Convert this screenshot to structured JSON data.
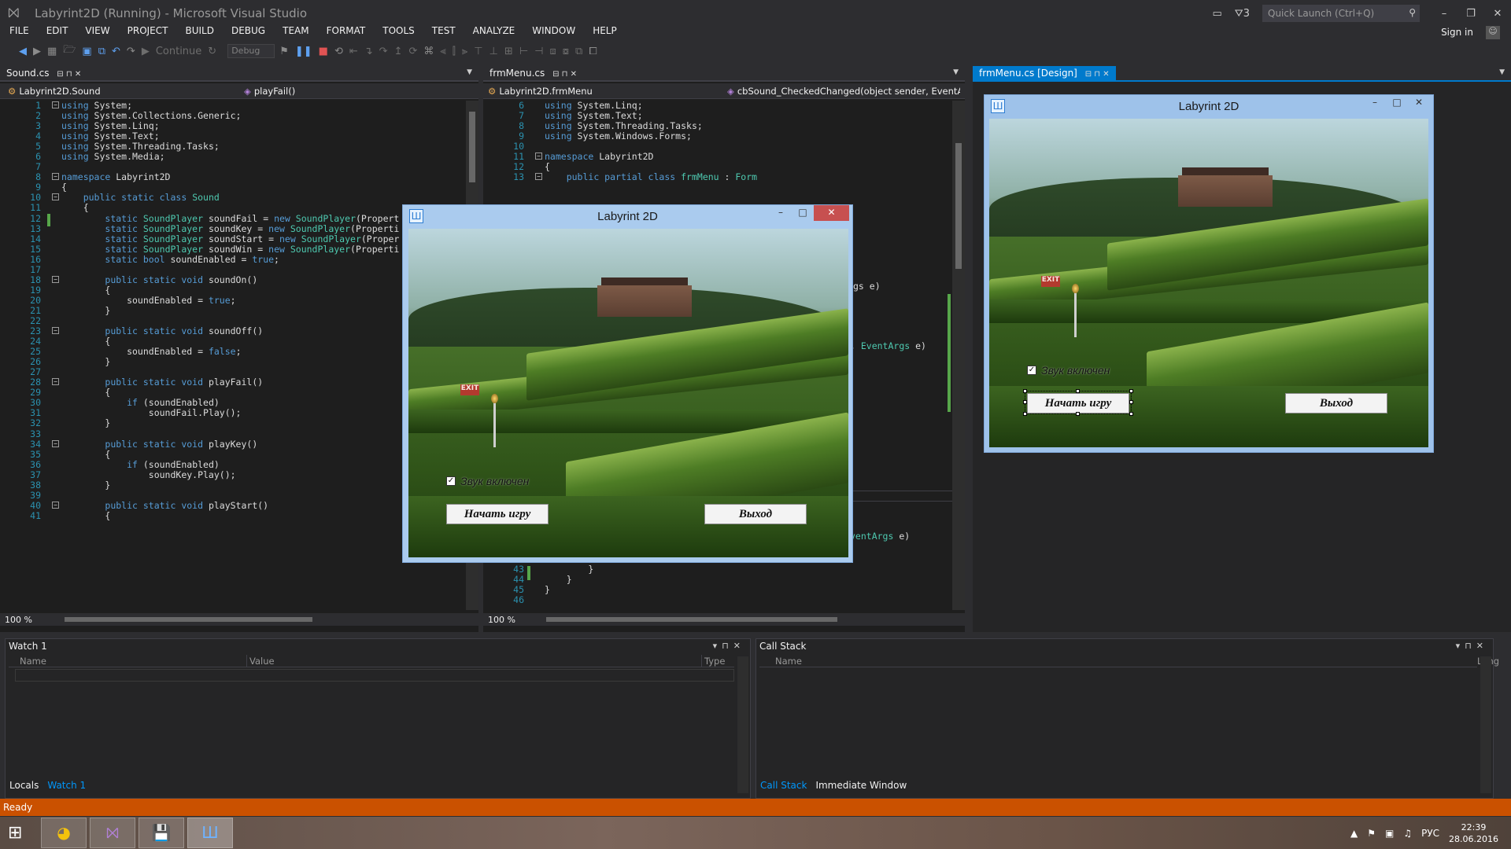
{
  "window": {
    "title": "Labyrint2D (Running) - Microsoft Visual Studio",
    "notifications_count": "3",
    "quick_launch_placeholder": "Quick Launch (Ctrl+Q)",
    "signin": "Sign in"
  },
  "menu": [
    "FILE",
    "EDIT",
    "VIEW",
    "PROJECT",
    "BUILD",
    "DEBUG",
    "TEAM",
    "FORMAT",
    "TOOLS",
    "TEST",
    "ANALYZE",
    "WINDOW",
    "HELP"
  ],
  "toolbar": {
    "continue_label": "Continue",
    "config": "Debug"
  },
  "sound_pane": {
    "tab": "Sound.cs",
    "nav_class": "Labyrint2D.Sound",
    "nav_member": "playFail()",
    "zoom": "100 %",
    "lines": [
      {
        "n": "1",
        "html": "<span class='k'>using</span> System;"
      },
      {
        "n": "2",
        "html": "<span class='k'>using</span> System.Collections.Generic;"
      },
      {
        "n": "3",
        "html": "<span class='k'>using</span> System.Linq;"
      },
      {
        "n": "4",
        "html": "<span class='k'>using</span> System.Text;"
      },
      {
        "n": "5",
        "html": "<span class='k'>using</span> System.Threading.Tasks;"
      },
      {
        "n": "6",
        "html": "<span class='k'>using</span> System.Media;"
      },
      {
        "n": "7",
        "html": ""
      },
      {
        "n": "8",
        "html": "<span class='k'>namespace</span> Labyrint2D"
      },
      {
        "n": "9",
        "html": "{"
      },
      {
        "n": "10",
        "html": "    <span class='k'>public static class</span> <span class='t'>Sound</span>"
      },
      {
        "n": "11",
        "html": "    {"
      },
      {
        "n": "12",
        "html": "        <span class='k'>static</span> <span class='t'>SoundPlayer</span> soundFail = <span class='k'>new</span> <span class='t'>SoundPlayer</span>(Propert"
      },
      {
        "n": "13",
        "html": "        <span class='k'>static</span> <span class='t'>SoundPlayer</span> soundKey = <span class='k'>new</span> <span class='t'>SoundPlayer</span>(Properti"
      },
      {
        "n": "14",
        "html": "        <span class='k'>static</span> <span class='t'>SoundPlayer</span> soundStart = <span class='k'>new</span> <span class='t'>SoundPlayer</span>(Proper"
      },
      {
        "n": "15",
        "html": "        <span class='k'>static</span> <span class='t'>SoundPlayer</span> soundWin = <span class='k'>new</span> <span class='t'>SoundPlayer</span>(Properti"
      },
      {
        "n": "16",
        "html": "        <span class='k'>static bool</span> soundEnabled = <span class='k'>true</span>;"
      },
      {
        "n": "17",
        "html": ""
      },
      {
        "n": "18",
        "html": "        <span class='k'>public static void</span> soundOn()"
      },
      {
        "n": "19",
        "html": "        {"
      },
      {
        "n": "20",
        "html": "            soundEnabled = <span class='k'>true</span>;"
      },
      {
        "n": "21",
        "html": "        }"
      },
      {
        "n": "22",
        "html": ""
      },
      {
        "n": "23",
        "html": "        <span class='k'>public static void</span> soundOff()"
      },
      {
        "n": "24",
        "html": "        {"
      },
      {
        "n": "25",
        "html": "            soundEnabled = <span class='k'>false</span>;"
      },
      {
        "n": "26",
        "html": "        }"
      },
      {
        "n": "27",
        "html": ""
      },
      {
        "n": "28",
        "html": "        <span class='k'>public static void</span> playFail()"
      },
      {
        "n": "29",
        "html": "        {"
      },
      {
        "n": "30",
        "html": "            <span class='k'>if</span> (soundEnabled)"
      },
      {
        "n": "31",
        "html": "                soundFail.Play();"
      },
      {
        "n": "32",
        "html": "        }"
      },
      {
        "n": "33",
        "html": ""
      },
      {
        "n": "34",
        "html": "        <span class='k'>public static void</span> playKey()"
      },
      {
        "n": "35",
        "html": "        {"
      },
      {
        "n": "36",
        "html": "            <span class='k'>if</span> (soundEnabled)"
      },
      {
        "n": "37",
        "html": "                soundKey.Play();"
      },
      {
        "n": "38",
        "html": "        }"
      },
      {
        "n": "39",
        "html": ""
      },
      {
        "n": "40",
        "html": "        <span class='k'>public static void</span> playStart()"
      },
      {
        "n": "41",
        "html": "        {"
      }
    ]
  },
  "menu_pane": {
    "tab": "frmMenu.cs",
    "nav_class": "Labyrint2D.frmMenu",
    "nav_member": "cbSound_CheckedChanged(object sender, EventAr",
    "zoom": "100 %",
    "lines_top": [
      {
        "n": "6",
        "html": "<span class='k'>using</span> System.Linq;"
      },
      {
        "n": "7",
        "html": "<span class='k'>using</span> System.Text;"
      },
      {
        "n": "8",
        "html": "<span class='k'>using</span> System.Threading.Tasks;"
      },
      {
        "n": "9",
        "html": "<span class='k'>using</span> System.Windows.Forms;"
      },
      {
        "n": "10",
        "html": ""
      },
      {
        "n": "11",
        "html": "<span class='k'>namespace</span> Labyrint2D"
      },
      {
        "n": "12",
        "html": "{"
      },
      {
        "n": "13",
        "html": "    <span class='k'>public partial class</span> <span class='t'>frmMenu</span> : <span class='t'>Form</span>"
      }
    ],
    "peek_1": "gs e)",
    "peek_2": ", <span class='t'>EventArgs</span> e)",
    "peek_3": "<span class='t'>ventArgs</span> e)",
    "lines_bottom": [
      {
        "n": "43",
        "html": "        }"
      },
      {
        "n": "44",
        "html": "    }"
      },
      {
        "n": "45",
        "html": "}"
      },
      {
        "n": "46",
        "html": ""
      }
    ]
  },
  "designer": {
    "tab": "frmMenu.cs [Design]"
  },
  "form": {
    "title": "Labyrint 2D",
    "exit_sign": "EXIT",
    "checkbox_label": "Звук включен",
    "checked": true,
    "start_button": "Начать игру",
    "exit_button": "Выход"
  },
  "watch": {
    "title": "Watch 1",
    "columns": [
      "Name",
      "Value",
      "Type"
    ],
    "tabs": [
      "Locals",
      "Watch 1"
    ]
  },
  "callstack": {
    "title": "Call Stack",
    "columns": [
      "Name",
      "Lang"
    ],
    "tabs": [
      "Call Stack",
      "Immediate Window"
    ]
  },
  "status": "Ready",
  "tray": {
    "lang": "РУС",
    "time": "22:39",
    "date": "28.06.2016"
  },
  "colors": {
    "status_bar": "#ca5100",
    "accent": "#007acc",
    "keyword": "#569cd6",
    "type": "#4ec9b0"
  }
}
